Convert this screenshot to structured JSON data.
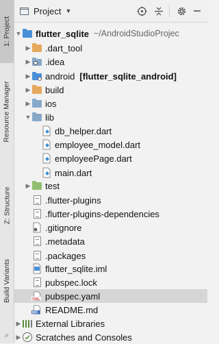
{
  "strip": {
    "tabs": [
      "1: Project",
      "Resource Manager",
      "Z: Structure",
      "Build Variants"
    ],
    "bottom_label": "⌕"
  },
  "header": {
    "title": "Project",
    "caret": "▼"
  },
  "tree": [
    {
      "label": "flutter_sqlite",
      "extra": "~/AndroidStudioProjec",
      "bold": true,
      "icon": "module-folder-icon",
      "arrow": "down",
      "level": 0
    },
    {
      "label": ".dart_tool",
      "icon": "folder-orange-icon",
      "arrow": "right",
      "level": 1
    },
    {
      "label": ".idea",
      "icon": "folder-gear-icon",
      "arrow": "right",
      "level": 1
    },
    {
      "label": "android",
      "extra": "[flutter_sqlite_android]",
      "extra_bold": true,
      "icon": "android-module-folder-icon",
      "arrow": "right",
      "level": 1
    },
    {
      "label": "build",
      "icon": "folder-orange-icon",
      "arrow": "right",
      "level": 1
    },
    {
      "label": "ios",
      "icon": "folder-icon",
      "arrow": "right",
      "level": 1
    },
    {
      "label": "lib",
      "icon": "folder-icon",
      "arrow": "down",
      "level": 1
    },
    {
      "label": "db_helper.dart",
      "icon": "dart-file-icon",
      "level": 2
    },
    {
      "label": "employee_model.dart",
      "icon": "dart-file-icon",
      "level": 2
    },
    {
      "label": "employeePage.dart",
      "icon": "dart-file-icon",
      "level": 2
    },
    {
      "label": "main.dart",
      "icon": "dart-file-icon",
      "level": 2
    },
    {
      "label": "test",
      "icon": "folder-green-icon",
      "arrow": "right",
      "level": 1
    },
    {
      "label": ".flutter-plugins",
      "icon": "text-file-icon",
      "level": 1
    },
    {
      "label": ".flutter-plugins-dependencies",
      "icon": "text-file-icon",
      "level": 1
    },
    {
      "label": ".gitignore",
      "icon": "gitignore-file-icon",
      "level": 1
    },
    {
      "label": ".metadata",
      "icon": "text-file-icon",
      "level": 1
    },
    {
      "label": ".packages",
      "icon": "text-file-icon",
      "level": 1
    },
    {
      "label": "flutter_sqlite.iml",
      "icon": "iml-file-icon",
      "level": 1
    },
    {
      "label": "pubspec.lock",
      "icon": "text-file-icon",
      "level": 1
    },
    {
      "label": "pubspec.yaml",
      "icon": "yaml-file-icon",
      "level": 1,
      "selected": true,
      "badge": "YML"
    },
    {
      "label": "README.md",
      "icon": "markdown-file-icon",
      "level": 1,
      "badge": "MD"
    },
    {
      "label": "External Libraries",
      "icon": "libraries-icon",
      "arrow": "right",
      "level": 0
    },
    {
      "label": "Scratches and Consoles",
      "icon": "scratches-icon",
      "arrow": "right",
      "level": 0
    }
  ],
  "colors": {
    "folder_blue": "#87a9c9",
    "folder_orange": "#e6a85c",
    "folder_green": "#8fbf6e",
    "module_blue": "#4a90d9",
    "dart_blue": "#3d8fd6",
    "selection": "#d6d6d6",
    "yaml_red": "#d94b4b",
    "md_blue": "#3b6fb6"
  }
}
